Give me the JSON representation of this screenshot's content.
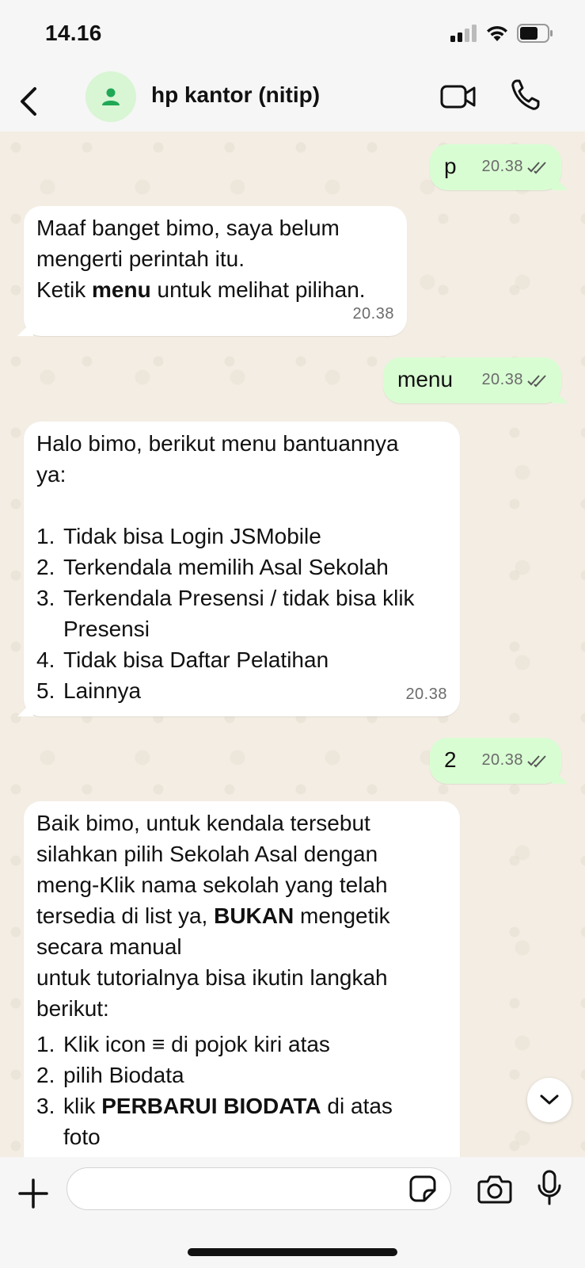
{
  "status_bar": {
    "time": "14.16"
  },
  "header": {
    "contact_name": "hp kantor (nitip)"
  },
  "messages": {
    "m1": {
      "text": "p",
      "time": "20.38"
    },
    "m2": {
      "line1": "Maaf banget bimo, saya belum",
      "line2": "mengerti perintah itu.",
      "line3_pre": "Ketik ",
      "line3_bold": "menu",
      "line3_post": " untuk melihat pilihan.",
      "time": "20.38"
    },
    "m3": {
      "text": "menu",
      "time": "20.38"
    },
    "m4": {
      "intro": "Halo bimo, berikut menu bantuannya ya:",
      "items": [
        {
          "num": "1.",
          "text": "Tidak bisa Login JSMobile"
        },
        {
          "num": "2.",
          "text": "Terkendala memilih Asal Sekolah"
        },
        {
          "num": "3.",
          "text": "Terkendala Presensi / tidak bisa klik Presensi"
        },
        {
          "num": "4.",
          "text": "Tidak bisa Daftar Pelatihan"
        },
        {
          "num": "5.",
          "text": "Lainnya"
        }
      ],
      "time": "20.38"
    },
    "m5": {
      "text": "2",
      "time": "20.38"
    },
    "m6": {
      "p1_pre": "Baik bimo, untuk kendala tersebut silahkan pilih Sekolah Asal dengan meng-Klik nama sekolah yang telah tersedia di list ya, ",
      "p1_bold": "BUKAN",
      "p1_post": " mengetik secara manual",
      "p2": "untuk tutorialnya bisa ikutin langkah berikut:",
      "items": [
        {
          "num": "1.",
          "text": "Klik icon ≡ di pojok kiri atas"
        },
        {
          "num": "2.",
          "text": "pilih Biodata"
        },
        {
          "num": "3.",
          "pre": "klik ",
          "bold": "PERBARUI BIODATA",
          "post": " di atas foto"
        }
      ]
    }
  },
  "input": {
    "placeholder": "",
    "value": ""
  },
  "colors": {
    "accent": "#25d366",
    "outgoing_bubble": "#d9fdd3",
    "incoming_bubble": "#ffffff"
  },
  "icons": [
    "back-chevron-icon",
    "person-icon",
    "video-camera-icon",
    "phone-icon",
    "double-check-icon",
    "chevron-down-icon",
    "plus-icon",
    "sticker-icon",
    "camera-icon",
    "microphone-icon"
  ]
}
